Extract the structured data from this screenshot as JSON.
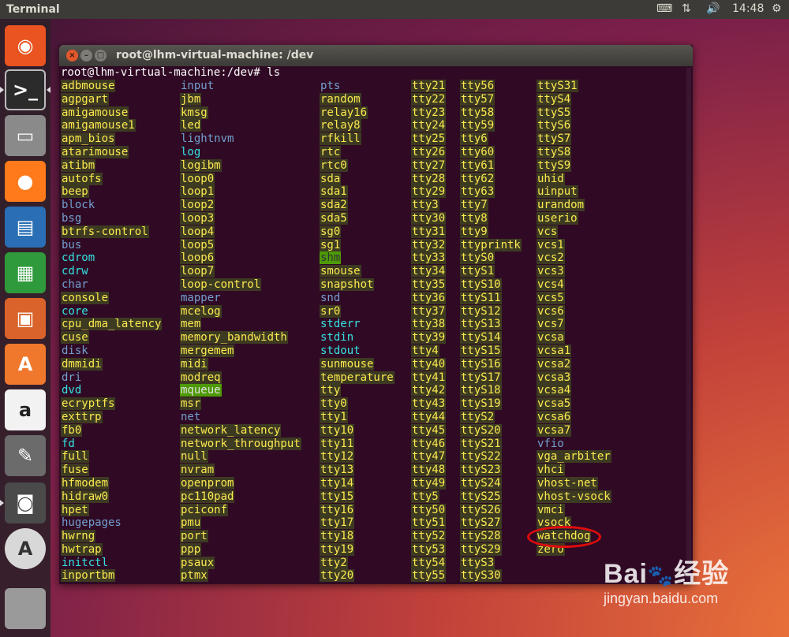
{
  "top_panel": {
    "app_title": "Terminal",
    "time": "14:48",
    "indicators": [
      "keyboard-icon",
      "network-updown-icon",
      "volume-icon"
    ]
  },
  "launcher": {
    "items": [
      {
        "name": "ubuntu-dash",
        "label": "",
        "color": "#e95420"
      },
      {
        "name": "terminal",
        "label": ">_",
        "color": "#2b2b2b"
      },
      {
        "name": "files",
        "label": "",
        "color": "#8a8a8a"
      },
      {
        "name": "firefox",
        "label": "",
        "color": "#ff7a1a"
      },
      {
        "name": "libreoffice-writer",
        "label": "",
        "color": "#2a6fb5"
      },
      {
        "name": "libreoffice-calc",
        "label": "",
        "color": "#2f9a3c"
      },
      {
        "name": "libreoffice-impress",
        "label": "",
        "color": "#d9632a"
      },
      {
        "name": "software-center",
        "label": "A",
        "color": "#f0782d"
      },
      {
        "name": "amazon",
        "label": "a",
        "color": "#f2f2f2"
      },
      {
        "name": "system-settings",
        "label": "",
        "color": "#6b6b6b"
      },
      {
        "name": "system-monitor",
        "label": "",
        "color": "#4a4a4a"
      },
      {
        "name": "software-updater",
        "label": "A",
        "color": "#d8d8d8"
      },
      {
        "name": "trash",
        "label": "",
        "color": "#9a9a9a"
      }
    ]
  },
  "window": {
    "title": "root@lhm-virtual-machine: /dev",
    "prompt": "root@lhm-virtual-machine:/dev# ls",
    "columns": [
      [
        "adbmouse",
        "agpgart",
        "amigamouse",
        "amigamouse1",
        "apm_bios",
        "atarimouse",
        "atibm",
        "autofs",
        "beep",
        "block",
        "bsg",
        "btrfs-control",
        "bus",
        "cdrom",
        "cdrw",
        "char",
        "console",
        "core",
        "cpu_dma_latency",
        "cuse",
        "disk",
        "dmmidi",
        "dri",
        "dvd",
        "ecryptfs",
        "exttrp",
        "fb0",
        "fd",
        "full",
        "fuse",
        "hfmodem",
        "hidraw0",
        "hpet",
        "hugepages",
        "hwrng",
        "hwtrap",
        "initctl",
        "inportbm"
      ],
      [
        "input",
        "jbm",
        "kmsg",
        "led",
        "lightnvm",
        "log",
        "logibm",
        "loop0",
        "loop1",
        "loop2",
        "loop3",
        "loop4",
        "loop5",
        "loop6",
        "loop7",
        "loop-control",
        "mapper",
        "mcelog",
        "mem",
        "memory_bandwidth",
        "mergemem",
        "midi",
        "modreq",
        "mqueue",
        "msr",
        "net",
        "network_latency",
        "network_throughput",
        "null",
        "nvram",
        "openprom",
        "pc110pad",
        "pciconf",
        "pmu",
        "port",
        "ppp",
        "psaux",
        "ptmx"
      ],
      [
        "pts",
        "random",
        "relay16",
        "relay8",
        "rfkill",
        "rtc",
        "rtc0",
        "sda",
        "sda1",
        "sda2",
        "sda5",
        "sg0",
        "sg1",
        "shm",
        "smouse",
        "snapshot",
        "snd",
        "sr0",
        "stderr",
        "stdin",
        "stdout",
        "sunmouse",
        "temperature",
        "tty",
        "tty0",
        "tty1",
        "tty10",
        "tty11",
        "tty12",
        "tty13",
        "tty14",
        "tty15",
        "tty16",
        "tty17",
        "tty18",
        "tty19",
        "tty2",
        "tty20"
      ],
      [
        "tty21",
        "tty22",
        "tty23",
        "tty24",
        "tty25",
        "tty26",
        "tty27",
        "tty28",
        "tty29",
        "tty3",
        "tty30",
        "tty31",
        "tty32",
        "tty33",
        "tty34",
        "tty35",
        "tty36",
        "tty37",
        "tty38",
        "tty39",
        "tty4",
        "tty40",
        "tty41",
        "tty42",
        "tty43",
        "tty44",
        "tty45",
        "tty46",
        "tty47",
        "tty48",
        "tty49",
        "tty5",
        "tty50",
        "tty51",
        "tty52",
        "tty53",
        "tty54",
        "tty55"
      ],
      [
        "tty56",
        "tty57",
        "tty58",
        "tty59",
        "tty6",
        "tty60",
        "tty61",
        "tty62",
        "tty63",
        "tty7",
        "tty8",
        "tty9",
        "ttyprintk",
        "ttyS0",
        "ttyS1",
        "ttyS10",
        "ttyS11",
        "ttyS12",
        "ttyS13",
        "ttyS14",
        "ttyS15",
        "ttyS16",
        "ttyS17",
        "ttyS18",
        "ttyS19",
        "ttyS2",
        "ttyS20",
        "ttyS21",
        "ttyS22",
        "ttyS23",
        "ttyS24",
        "ttyS25",
        "ttyS26",
        "ttyS27",
        "ttyS28",
        "ttyS29",
        "ttyS3",
        "ttyS30"
      ],
      [
        "ttyS31",
        "ttyS4",
        "ttyS5",
        "ttyS6",
        "ttyS7",
        "ttyS8",
        "ttyS9",
        "uhid",
        "uinput",
        "urandom",
        "userio",
        "vcs",
        "vcs1",
        "vcs2",
        "vcs3",
        "vcs4",
        "vcs5",
        "vcs6",
        "vcs7",
        "vcsa",
        "vcsa1",
        "vcsa2",
        "vcsa3",
        "vcsa4",
        "vcsa5",
        "vcsa6",
        "vcsa7",
        "vfio",
        "vga_arbiter",
        "vhci",
        "vhost-net",
        "vhost-vsock",
        "vmci",
        "vsock",
        "watchdog",
        "zero"
      ]
    ],
    "entry_types": {
      "dir": [
        "block",
        "bsg",
        "bus",
        "char",
        "disk",
        "dri",
        "hugepages",
        "input",
        "lightnvm",
        "mapper",
        "net",
        "pts",
        "snd",
        "vfio"
      ],
      "link": [
        "cdrom",
        "cdrw",
        "core",
        "dvd",
        "fd",
        "initctl",
        "log",
        "stderr",
        "stdin",
        "stdout"
      ],
      "sticky": [
        "shm",
        "mqueue"
      ]
    },
    "highlighted_entry": "watchdog"
  },
  "watermark": {
    "brand": "Bai",
    "brand_suffix": "经验",
    "url": "jingyan.baidu.com"
  },
  "colors": {
    "terminal_bg": "#300a24",
    "char_device_fg": "#fce94f",
    "char_device_bg": "#3d3a22",
    "dir_fg": "#729fcf",
    "link_fg": "#34e2e2",
    "sticky_bg": "#4e9a06",
    "highlight_ring": "#e00c0c"
  }
}
